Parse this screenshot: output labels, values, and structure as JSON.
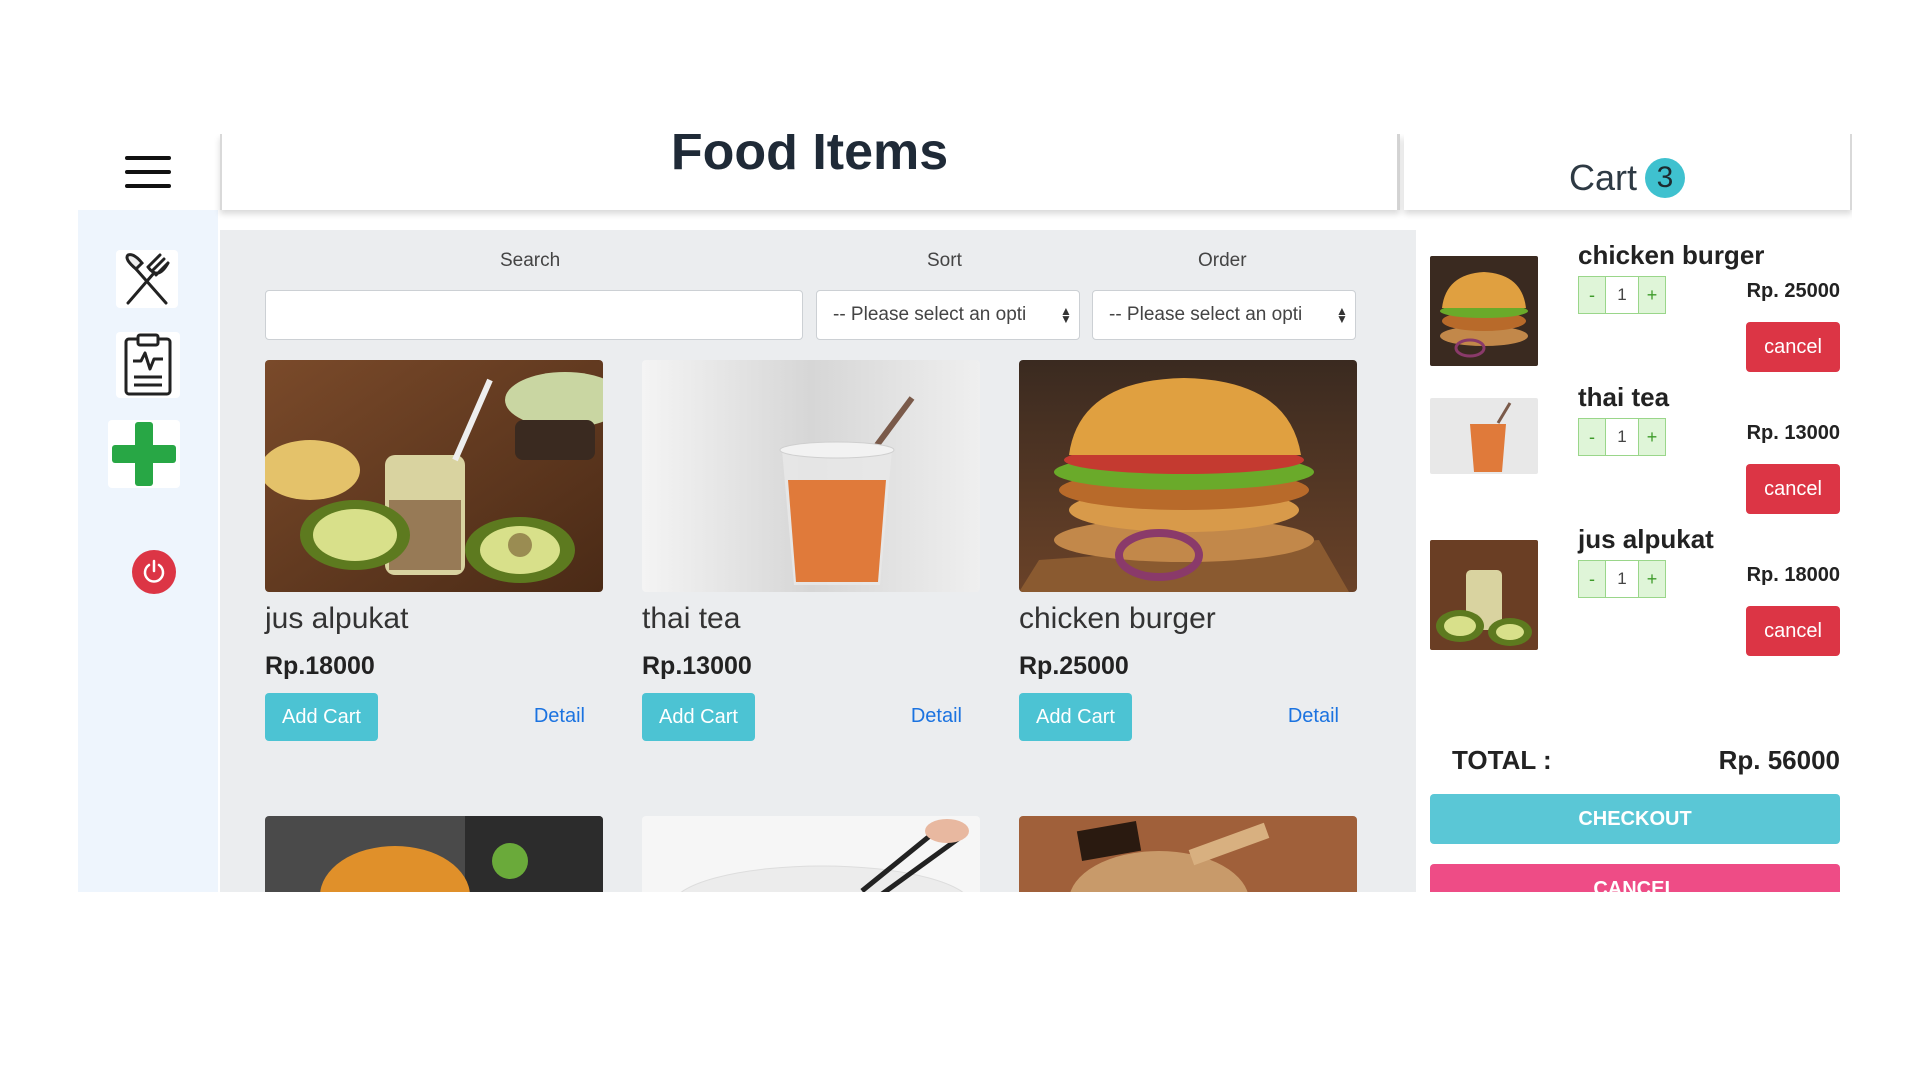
{
  "header": {
    "title": "Food Items"
  },
  "cart_header": {
    "title": "Cart",
    "count": "3"
  },
  "sidebar": {
    "items": [
      {
        "icon": "fork-knife-icon"
      },
      {
        "icon": "clipboard-report-icon"
      },
      {
        "icon": "plus-icon",
        "color": "#28a745"
      },
      {
        "icon": "power-icon",
        "color": "#dc3545"
      }
    ]
  },
  "filters": {
    "search_label": "Search",
    "search_value": "",
    "sort_label": "Sort",
    "sort_value": "-- Please select an opti",
    "order_label": "Order",
    "order_value": "-- Please select an opti"
  },
  "products": [
    {
      "name": "jus alpukat",
      "price": "Rp.18000",
      "add_label": "Add Cart",
      "detail_label": "Detail"
    },
    {
      "name": "thai tea",
      "price": "Rp.13000",
      "add_label": "Add Cart",
      "detail_label": "Detail"
    },
    {
      "name": "chicken burger",
      "price": "Rp.25000",
      "add_label": "Add Cart",
      "detail_label": "Detail"
    }
  ],
  "cart": {
    "items": [
      {
        "name": "chicken burger",
        "qty": "1",
        "minus": "-",
        "plus": "+",
        "price": "Rp. 25000",
        "cancel_label": "cancel"
      },
      {
        "name": "thai tea",
        "qty": "1",
        "minus": "-",
        "plus": "+",
        "price": "Rp. 13000",
        "cancel_label": "cancel"
      },
      {
        "name": "jus alpukat",
        "qty": "1",
        "minus": "-",
        "plus": "+",
        "price": "Rp. 18000",
        "cancel_label": "cancel"
      }
    ],
    "total_label": "TOTAL :",
    "total_value": "Rp. 56000",
    "checkout_label": "CHECKOUT",
    "cancel_all_label": "CANCEL"
  },
  "colors": {
    "accent": "#4cc3d3",
    "danger": "#dc3545",
    "pink": "#ee4c86",
    "sidebar_bg": "#eef5fd"
  }
}
